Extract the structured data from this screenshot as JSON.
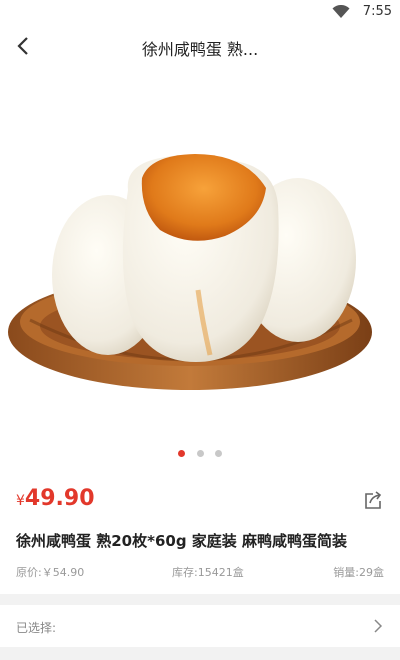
{
  "status_bar": {
    "time": "7:55"
  },
  "nav": {
    "title": "徐州咸鸭蛋 熟..."
  },
  "gallery": {
    "image": "salted-duck-eggs-in-wooden-bowl",
    "page_count": 3,
    "active_index": 0
  },
  "product": {
    "currency": "¥",
    "price": "49.90",
    "title": "徐州咸鸭蛋 熟20枚*60g 家庭装 麻鸭咸鸭蛋简装",
    "original_price": "原价:￥54.90",
    "stock": "库存:15421盒",
    "sales": "销量:29盒"
  },
  "selection": {
    "label": "已选择:"
  },
  "colors": {
    "accent": "#e2382b"
  }
}
